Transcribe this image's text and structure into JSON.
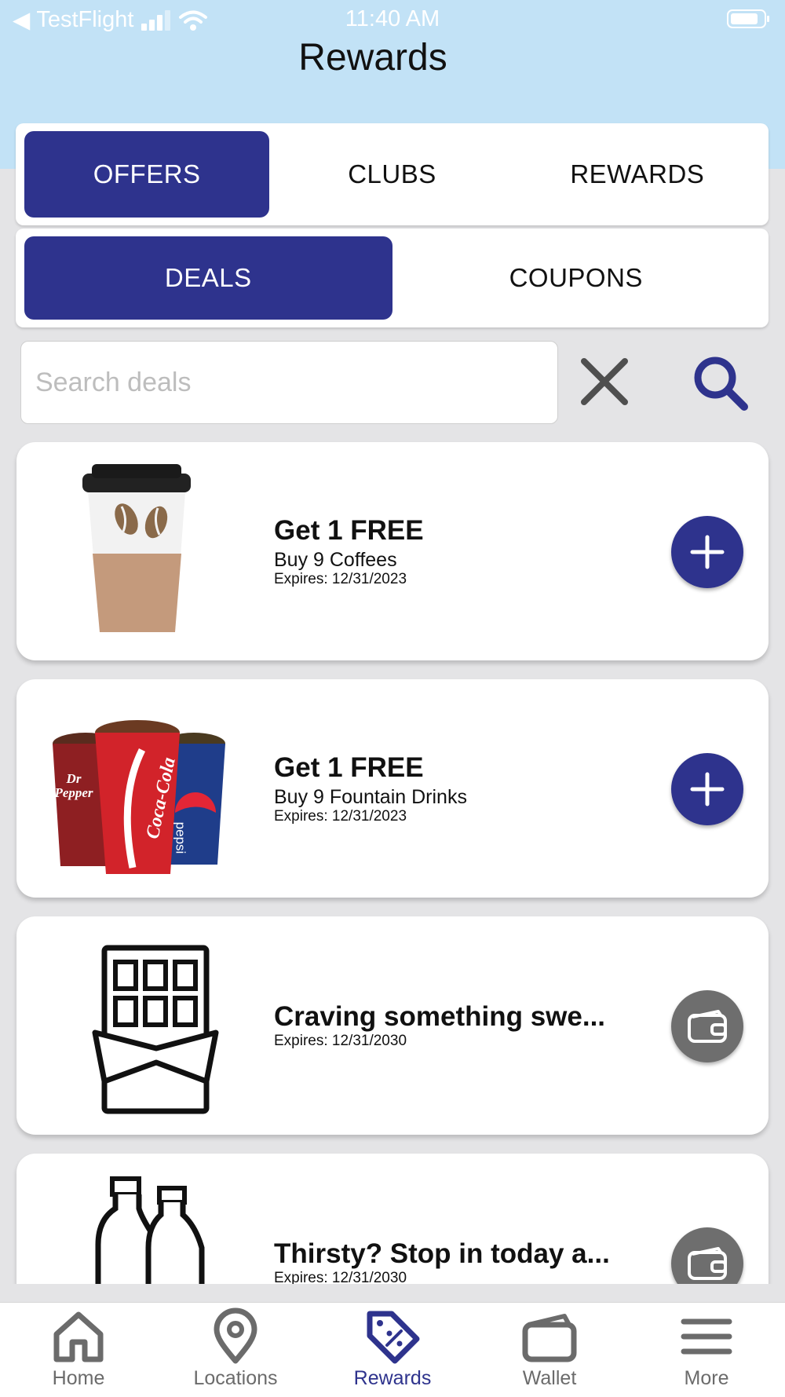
{
  "status_bar": {
    "back_app": "TestFlight",
    "time": "11:40 AM"
  },
  "header": {
    "title": "Rewards"
  },
  "main_tabs": [
    {
      "label": "OFFERS",
      "active": true
    },
    {
      "label": "CLUBS",
      "active": false
    },
    {
      "label": "REWARDS",
      "active": false
    }
  ],
  "sub_tabs": [
    {
      "label": "DEALS",
      "active": true
    },
    {
      "label": "COUPONS",
      "active": false
    }
  ],
  "search": {
    "placeholder": "Search deals",
    "value": ""
  },
  "deals": [
    {
      "title": "Get 1 FREE",
      "subtitle": "Buy 9 Coffees",
      "expires": "Expires: 12/31/2023",
      "image": "coffee-cup",
      "action": "add-icon"
    },
    {
      "title": "Get 1 FREE",
      "subtitle": "Buy 9 Fountain Drinks",
      "expires": "Expires: 12/31/2023",
      "image": "fountain-drinks",
      "action": "add-icon",
      "brands": [
        "Dr Pepper",
        "Coca-Cola",
        "pepsi"
      ]
    },
    {
      "title": "Craving something swe...",
      "expires": "Expires: 12/31/2030",
      "image": "chocolate-bar",
      "action": "wallet-icon"
    },
    {
      "title": "Thirsty? Stop in today a...",
      "expires": "Expires: 12/31/2030",
      "image": "bottles",
      "action": "wallet-icon"
    }
  ],
  "bottom_nav": [
    {
      "label": "Home",
      "icon": "home-icon"
    },
    {
      "label": "Locations",
      "icon": "location-pin-icon"
    },
    {
      "label": "Rewards",
      "icon": "tag-percent-icon",
      "active": true
    },
    {
      "label": "Wallet",
      "icon": "wallet-icon"
    },
    {
      "label": "More",
      "icon": "menu-icon"
    }
  ],
  "colors": {
    "primary": "#2e338d",
    "header_bg": "#c2e2f6",
    "page_bg": "#e4e4e6",
    "wallet_button": "#6e6e6e"
  }
}
